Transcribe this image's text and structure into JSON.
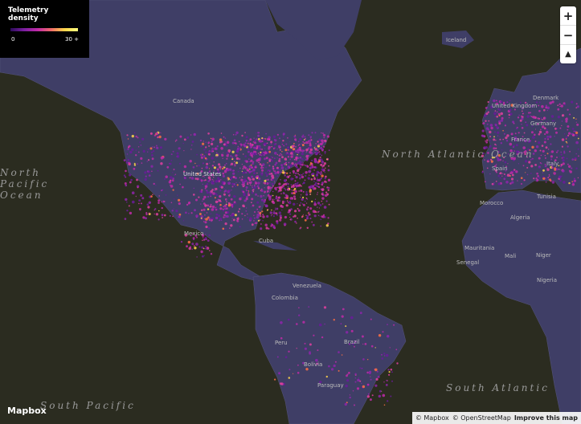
{
  "legend": {
    "title": "Telemetry density",
    "min_label": "0",
    "max_label": "30 +"
  },
  "controls": {
    "zoom_in": "+",
    "zoom_out": "−",
    "compass": "▲"
  },
  "logo": "Mapbox",
  "attribution": {
    "mapbox": "© Mapbox",
    "osm": "© OpenStreetMap",
    "improve": "Improve this map"
  },
  "countries": [
    {
      "name": "Iceland"
    },
    {
      "name": "Canada"
    },
    {
      "name": "United Kingdom"
    },
    {
      "name": "Denmark"
    },
    {
      "name": "Germany"
    },
    {
      "name": "France"
    },
    {
      "name": "Spain"
    },
    {
      "name": "Italy"
    },
    {
      "name": "Tunisia"
    },
    {
      "name": "Morocco"
    },
    {
      "name": "Algeria"
    },
    {
      "name": "Mauritania"
    },
    {
      "name": "Mali"
    },
    {
      "name": "Niger"
    },
    {
      "name": "Senegal"
    },
    {
      "name": "Nigeria"
    },
    {
      "name": "Mexico"
    },
    {
      "name": "Cuba"
    },
    {
      "name": "Venezuela"
    },
    {
      "name": "Colombia"
    },
    {
      "name": "Peru"
    },
    {
      "name": "Brazil"
    },
    {
      "name": "Bolivia"
    },
    {
      "name": "Paraguay"
    },
    {
      "name": "United States"
    }
  ],
  "oceans": [
    {
      "name": "North Atlantic Ocean"
    },
    {
      "name": "North Pacific Ocean"
    },
    {
      "name": "South Atlantic"
    },
    {
      "name": "South Pacific"
    }
  ],
  "colors": {
    "land": "#3e3d63",
    "background": "#2b2c20",
    "density_low": "#7a1fa0",
    "density_high": "#ffd54a"
  }
}
